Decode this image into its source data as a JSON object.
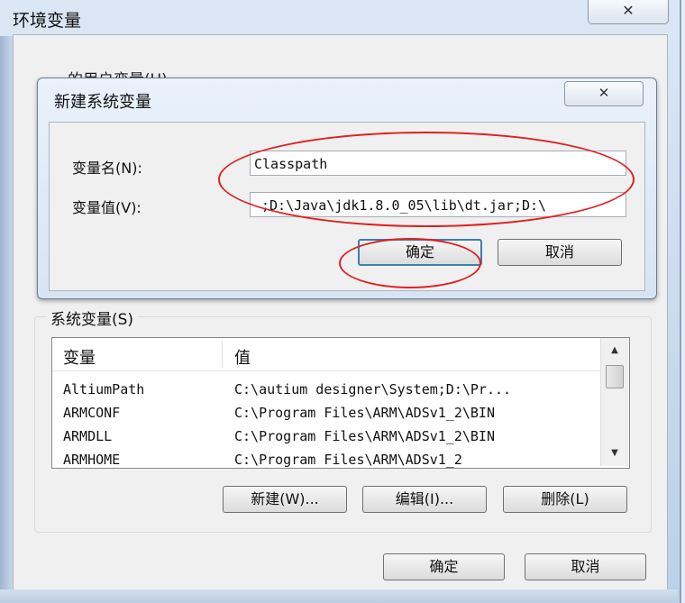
{
  "outer_window": {
    "title": "环境变量",
    "close_glyph": "✕",
    "user_vars_label": "…的用户变量(U)",
    "ok_label": "确定",
    "cancel_label": "取消"
  },
  "dialog": {
    "title": "新建系统变量",
    "close_glyph": "✕",
    "name_label": "变量名(N):",
    "name_value": "Classpath",
    "value_label": "变量值(V):",
    "value_value": ";D:\\Java\\jdk1.8.0_05\\lib\\dt.jar;D:\\",
    "ok_label": "确定",
    "cancel_label": "取消",
    "annotation_color": "#e02020"
  },
  "system_vars": {
    "group_label": "系统变量(S)",
    "columns": [
      "变量",
      "值"
    ],
    "rows": [
      {
        "name": "AltiumPath",
        "value": "C:\\autium designer\\System;D:\\Pr..."
      },
      {
        "name": "ARMCONF",
        "value": "C:\\Program Files\\ARM\\ADSv1_2\\BIN"
      },
      {
        "name": "ARMDLL",
        "value": "C:\\Program Files\\ARM\\ADSv1_2\\BIN"
      },
      {
        "name": "ARMHOME",
        "value": "C:\\Program Files\\ARM\\ADSv1_2"
      }
    ],
    "new_label": "新建(W)...",
    "edit_label": "编辑(I)...",
    "delete_label": "删除(L)"
  },
  "icons": {
    "scroll_up": "chevron-up-icon",
    "scroll_down": "chevron-down-icon"
  }
}
